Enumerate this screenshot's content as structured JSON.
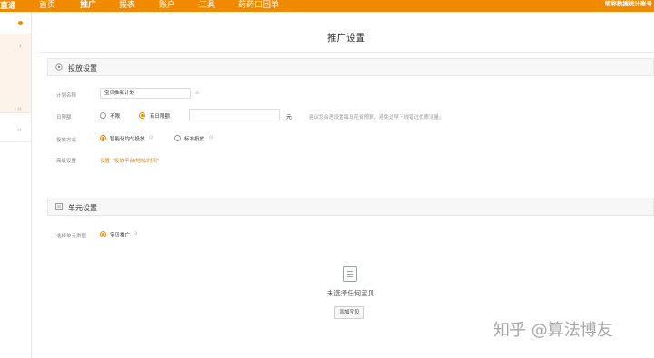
{
  "topbar": {
    "logo_text": "直通车",
    "nav": [
      "首页",
      "推广",
      "报表",
      "账户",
      "工具",
      "药药口回单"
    ],
    "active_index": 1,
    "user_text": "昵称数据统计账号",
    "accent_color": "#f28a00"
  },
  "sidebar": {
    "arrow_glyph": "›",
    "rows": [
      "‹‹",
      "‹‹"
    ]
  },
  "page": {
    "title": "推广设置"
  },
  "delivery": {
    "section_title": "投放设置",
    "icon": "settings-icon",
    "plan_name_label": "计划名称",
    "plan_name_value": "宝贝推新计划",
    "daily_budget_label": "日限额",
    "budget_options": [
      "不限",
      "有日限额"
    ],
    "budget_selected_index": 1,
    "budget_input_value": "",
    "budget_unit": "元",
    "budget_hint": "建议您合理设置每日花费预算，避免过早下线错过优质流量。",
    "delivery_method_label": "投放方式",
    "delivery_options": [
      "智能化均匀投放",
      "标准投放"
    ],
    "delivery_selected_index": 0,
    "advanced_label": "高级设置",
    "advanced_link": "设置",
    "advanced_sub": "“投放平台/地域/时间”"
  },
  "unit": {
    "section_title": "单元设置",
    "icon": "unit-icon",
    "select_label": "选择单元类型",
    "unit_option": "宝贝推广",
    "empty_text": "未选择任何宝贝",
    "add_button": "添加宝贝"
  },
  "watermark": {
    "text": "知乎 @算法博友"
  }
}
